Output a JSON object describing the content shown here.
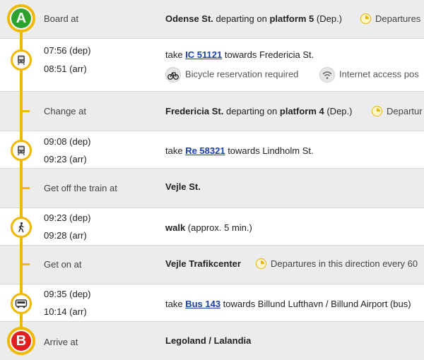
{
  "colors": {
    "track": "#f0b800",
    "start": "#2ea22e",
    "end": "#e02020",
    "link": "#1a3fa8"
  },
  "start": {
    "letter": "A",
    "label": "Board at",
    "station": "Odense St.",
    "mid": " departing on ",
    "platform": "platform 5",
    "dep": " (Dep.)",
    "departures": "Departures"
  },
  "leg1": {
    "dep": "07:56 (dep)",
    "arr": "08:51 (arr)",
    "take": "take ",
    "train": "IC 51121",
    "towards": " towards Fredericia St.",
    "bike": "Bicycle reservation required",
    "wifi": "Internet access pos"
  },
  "change": {
    "label": "Change at",
    "station": "Fredericia St.",
    "mid": " departing on ",
    "platform": "platform 4",
    "dep": " (Dep.)",
    "departures": "Departur"
  },
  "leg2": {
    "dep": "09:08 (dep)",
    "arr": "09:23 (arr)",
    "take": "take ",
    "train": "Re 58321",
    "towards": " towards Lindholm St."
  },
  "getoff": {
    "label": "Get off the train at",
    "station": "Vejle St."
  },
  "walk": {
    "dep": "09:23 (dep)",
    "arr": "09:28 (arr)",
    "mode": "walk",
    "rest": " (approx. 5 min.)"
  },
  "geton": {
    "label": "Get on at",
    "station": "Vejle Trafikcenter",
    "departures": "Departures in this direction every 60"
  },
  "leg3": {
    "dep": "09:35 (dep)",
    "arr": "10:14 (arr)",
    "take": "take ",
    "bus": "Bus 143",
    "towards": " towards Billund Lufthavn / Billund Airport (bus)"
  },
  "end": {
    "letter": "B",
    "label": "Arrive at",
    "station": "Legoland / Lalandia"
  }
}
